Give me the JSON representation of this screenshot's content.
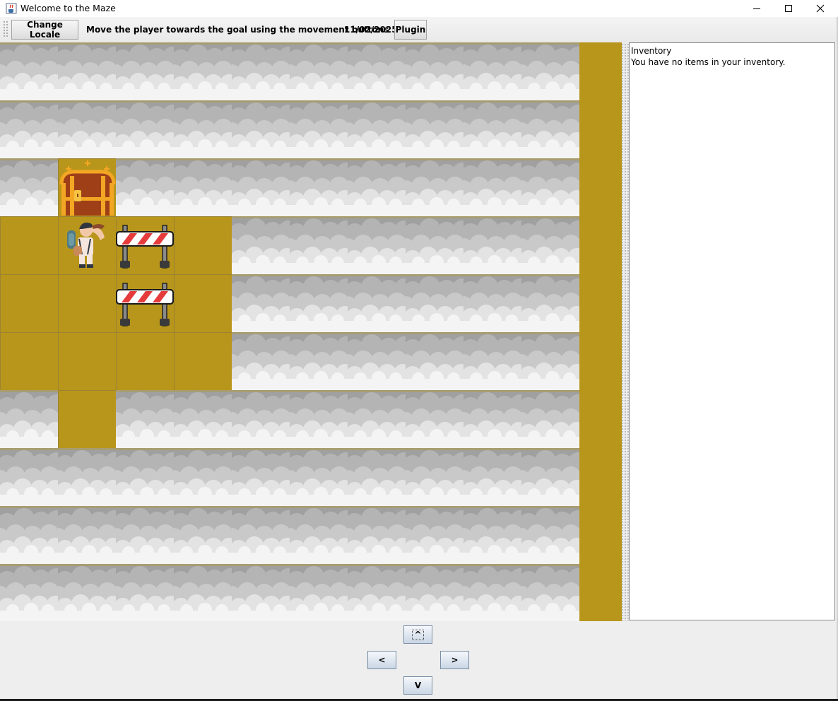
{
  "window": {
    "title": "Welcome to the Maze",
    "app_icon": "java-cup-icon",
    "controls": [
      "minimize-icon",
      "maximize-icon",
      "close-icon"
    ]
  },
  "toolbar": {
    "change_locale_label": "Change Locale",
    "instructions": "Move the player towards the goal using the movement buttons",
    "date": "11/02/2025",
    "plugin_label": "Plugin"
  },
  "maze": {
    "colors": {
      "floor": "#b8961b",
      "cloud_dark": "#9b9b9b",
      "cloud_light": "#f2f2f2"
    },
    "grid": {
      "columns": 10,
      "rows": 10,
      "legend": {
        "C": "cloud-wall",
        ".": "floor",
        "G": "treasure-chest-goal",
        "P": "player",
        "B": "barricade"
      },
      "rows_layout": [
        "CCCCCCCCCC",
        "CCCCCCCCCC",
        "CGCCCCCCCC",
        ".PB.CCCCCC",
        "..B.CCCCCC",
        "....CCCCCC",
        "C.CCCCCCCC",
        "CCCCCCCCCC",
        "CCCCCCCCCC",
        "CCCCCCCCCC"
      ]
    }
  },
  "inventory": {
    "title": "Inventory",
    "message": "You have no items in your inventory."
  },
  "movement": {
    "up_label": "^",
    "left_label": "<",
    "right_label": ">",
    "down_label": "V"
  }
}
